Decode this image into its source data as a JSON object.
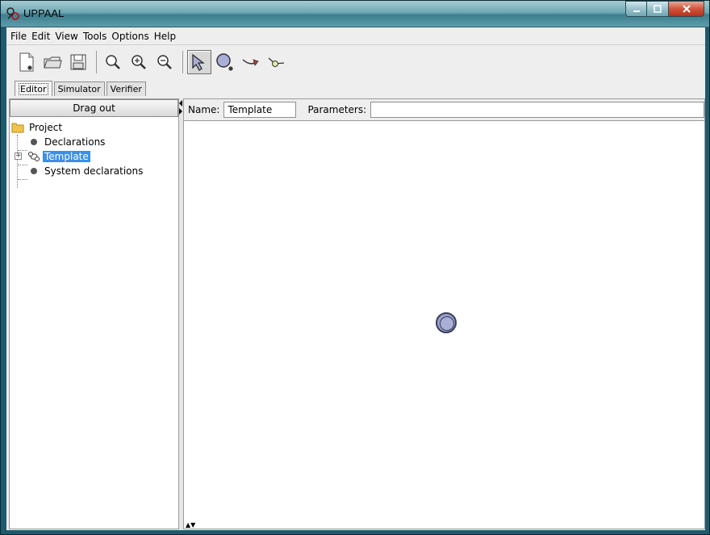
{
  "window": {
    "title": "UPPAAL"
  },
  "menu": [
    "File",
    "Edit",
    "View",
    "Tools",
    "Options",
    "Help"
  ],
  "toolbar": {
    "buttons": [
      {
        "icon": "new-document-icon"
      },
      {
        "icon": "open-folder-icon"
      },
      {
        "icon": "save-disk-icon"
      },
      {
        "icon": "zoom-icon"
      },
      {
        "icon": "zoom-in-icon"
      },
      {
        "icon": "zoom-out-icon"
      },
      {
        "icon": "select-arrow-icon",
        "active": true
      },
      {
        "icon": "add-location-icon"
      },
      {
        "icon": "add-edge-icon"
      },
      {
        "icon": "add-nail-icon"
      }
    ]
  },
  "tabs": [
    "Editor",
    "Simulator",
    "Verifier"
  ],
  "selected_tab": "Editor",
  "left_panel": {
    "drag_out_label": "Drag out",
    "tree": [
      {
        "label": "Project",
        "type": "folder"
      },
      {
        "label": "Declarations",
        "type": "leaf"
      },
      {
        "label": "Template",
        "type": "template",
        "selected": true
      },
      {
        "label": "System declarations",
        "type": "leaf"
      }
    ]
  },
  "editor": {
    "name_label": "Name:",
    "name_value": "Template",
    "parameters_label": "Parameters:",
    "parameters_value": ""
  },
  "colors": {
    "selection": "#3b8fe6",
    "location_fill": "#9aa0c8"
  }
}
